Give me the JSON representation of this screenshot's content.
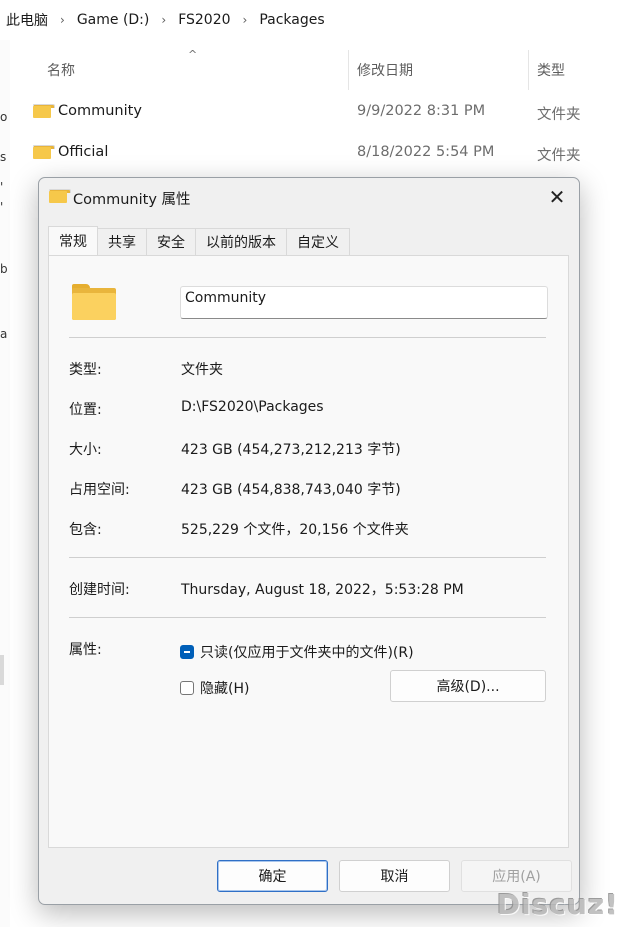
{
  "breadcrumb": [
    "此电脑",
    "Game (D:)",
    "FS2020",
    "Packages"
  ],
  "breadcrumb_separator": "›",
  "left_fragments": [
    "o",
    "s",
    "'",
    "'",
    "b",
    "a"
  ],
  "columns": {
    "name": "名称",
    "date": "修改日期",
    "type": "类型",
    "sort_indicator": "^"
  },
  "files": [
    {
      "name": "Community",
      "date": "9/9/2022 8:31 PM",
      "type": "文件夹"
    },
    {
      "name": "Official",
      "date": "8/18/2022 5:54 PM",
      "type": "文件夹"
    }
  ],
  "dialog": {
    "title": "Community 属性",
    "close_glyph": "✕",
    "tabs": [
      "常规",
      "共享",
      "安全",
      "以前的版本",
      "自定义"
    ],
    "active_tab": "常规",
    "folder_name": "Community",
    "props": {
      "type": {
        "label": "类型:",
        "value": "文件夹"
      },
      "location": {
        "label": "位置:",
        "value": "D:\\FS2020\\Packages"
      },
      "size": {
        "label": "大小:",
        "value": "423 GB (454,273,212,213 字节)"
      },
      "size_on_disk": {
        "label": "占用空间:",
        "value": "423 GB (454,838,743,040 字节)"
      },
      "contains": {
        "label": "包含:",
        "value": "525,229 个文件，20,156 个文件夹"
      },
      "created": {
        "label": "创建时间:",
        "value": "Thursday, August 18, 2022，5:53:28 PM"
      }
    },
    "attributes_label": "属性:",
    "readonly_label": "只读(仅应用于文件夹中的文件)(R)",
    "readonly_state": "indeterminate",
    "hidden_label": "隐藏(H)",
    "hidden_state": "unchecked",
    "advanced_button": "高级(D)...",
    "ok_button": "确定",
    "cancel_button": "取消",
    "apply_button": "应用(A)"
  },
  "watermark": "Discuz!",
  "colors": {
    "accent": "#005fb8",
    "folder": "#f6c84a",
    "dialog_bg": "#f0f0f0",
    "panel_bg": "#f9f9f9"
  }
}
